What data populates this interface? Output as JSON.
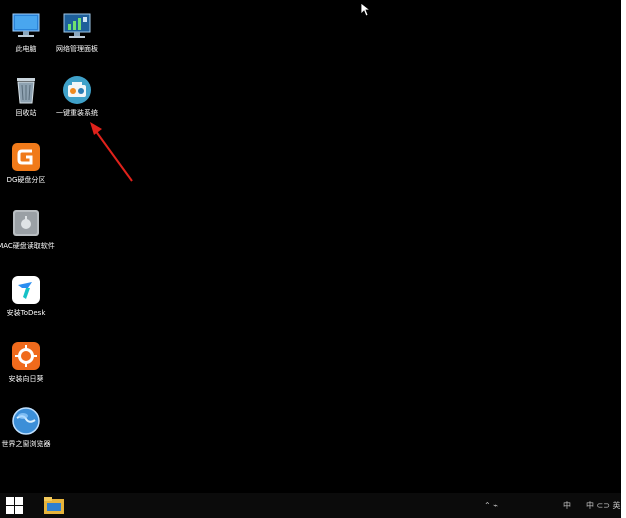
{
  "desktop": {
    "icons": [
      {
        "label": "此电脑",
        "icon": "computer-icon"
      },
      {
        "label": "网络管理面板",
        "icon": "network-panel-icon"
      },
      {
        "label": "回收站",
        "icon": "recycle-bin-icon"
      },
      {
        "label": "一键重装系统",
        "icon": "one-click-reinstall-icon"
      },
      {
        "label": "DG硬盘分区",
        "icon": "diskgenius-icon"
      },
      {
        "label": "MAC硬盘读取软件",
        "icon": "mac-disk-reader-icon"
      },
      {
        "label": "安装ToDesk",
        "icon": "todesk-icon"
      },
      {
        "label": "安装向日葵",
        "icon": "sunflower-icon"
      },
      {
        "label": "世界之窗浏览器",
        "icon": "theworld-browser-icon"
      }
    ]
  },
  "taskbar": {
    "tray_left": "⌃ ⌁",
    "tray_lang": "中",
    "tray_right": "中 ⊂⊃ 英"
  },
  "colors": {
    "desktop_bg": "#000000",
    "taskbar_bg": "#0b0b0b",
    "arrow": "#e0221b"
  }
}
